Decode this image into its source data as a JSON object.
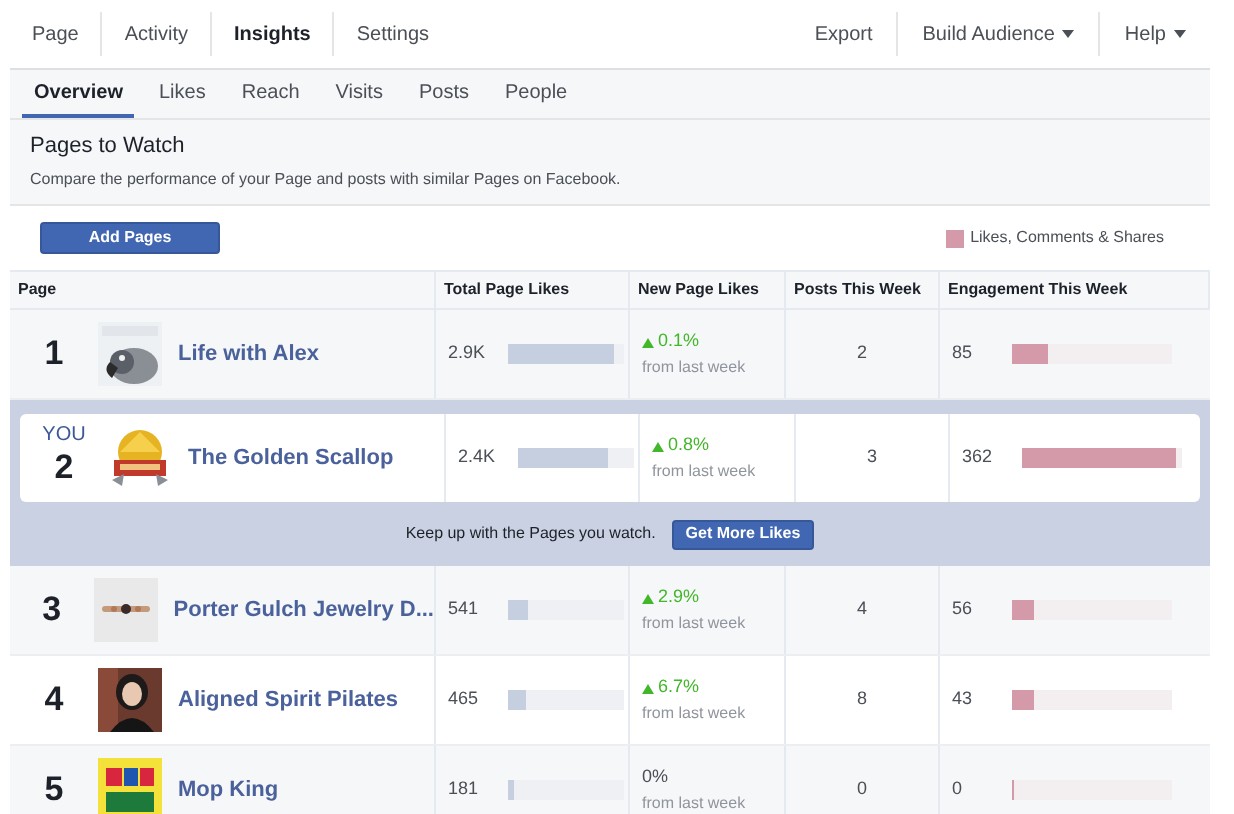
{
  "top_nav": {
    "left": [
      {
        "label": "Page",
        "selected": false
      },
      {
        "label": "Activity",
        "selected": false
      },
      {
        "label": "Insights",
        "selected": true
      },
      {
        "label": "Settings",
        "selected": false
      }
    ],
    "right": [
      {
        "label": "Export",
        "dropdown": false
      },
      {
        "label": "Build Audience",
        "dropdown": true
      },
      {
        "label": "Help",
        "dropdown": true
      }
    ]
  },
  "sub_tabs": [
    {
      "label": "Overview",
      "selected": true
    },
    {
      "label": "Likes",
      "selected": false
    },
    {
      "label": "Reach",
      "selected": false
    },
    {
      "label": "Visits",
      "selected": false
    },
    {
      "label": "Posts",
      "selected": false
    },
    {
      "label": "People",
      "selected": false
    }
  ],
  "section": {
    "title": "Pages to Watch",
    "description": "Compare the performance of your Page and posts with similar Pages on Facebook."
  },
  "add_button": "Add Pages",
  "legend": {
    "label": "Likes, Comments & Shares",
    "color": "#d49aaa"
  },
  "table": {
    "columns": [
      "Page",
      "Total Page Likes",
      "New Page Likes",
      "Posts This Week",
      "Engagement This Week"
    ],
    "rows": [
      {
        "kind": "other",
        "rank": "1",
        "name": "Life with Alex",
        "likes": {
          "text": "2.9K",
          "level": 0.92
        },
        "change": "0.1%",
        "rising": true,
        "change_note": "from last week",
        "posts": "2",
        "engagement": {
          "text": "85",
          "level": 0.23
        }
      },
      {
        "kind": "you",
        "you_label": "YOU",
        "rank": "2",
        "name": "The Golden Scallop",
        "likes": {
          "text": "2.4K",
          "level": 0.77
        },
        "change": "0.8%",
        "rising": true,
        "change_note": "from last week",
        "posts": "3",
        "engagement": {
          "text": "362",
          "level": 0.96
        }
      },
      {
        "kind": "other",
        "rank": "3",
        "name": "Porter Gulch Jewelry D...",
        "likes": {
          "text": "541",
          "level": 0.17
        },
        "change": "2.9%",
        "rising": true,
        "change_note": "from last week",
        "posts": "4",
        "engagement": {
          "text": "56",
          "level": 0.14
        }
      },
      {
        "kind": "other",
        "rank": "4",
        "name": "Aligned Spirit Pilates",
        "likes": {
          "text": "465",
          "level": 0.15
        },
        "change": "6.7%",
        "rising": true,
        "change_note": "from last week",
        "posts": "8",
        "engagement": {
          "text": "43",
          "level": 0.14
        }
      },
      {
        "kind": "other",
        "rank": "5",
        "name": "Mop King",
        "likes": {
          "text": "181",
          "level": 0.05
        },
        "change": "0%",
        "rising": false,
        "change_note": "from last week",
        "posts": "0",
        "engagement": {
          "text": "0",
          "level": 0.01
        }
      }
    ]
  },
  "banner": {
    "text": "Keep up with the Pages you watch.",
    "button": "Get More Likes"
  }
}
